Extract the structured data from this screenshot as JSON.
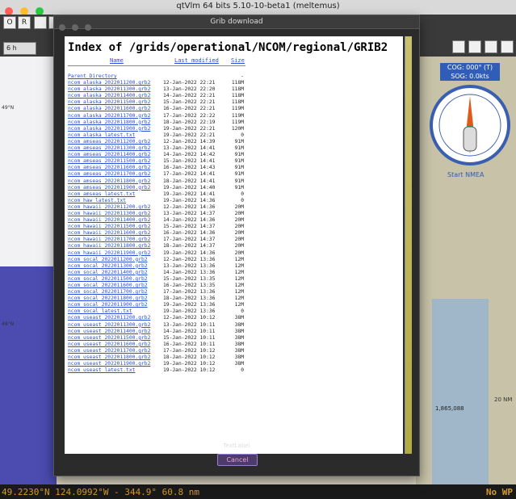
{
  "app": {
    "window_title": "qtVlm 64 bits 5.10-10-beta1 (meltemus)",
    "toolbar_select_value": "6 h",
    "toolbar_letters": [
      "O",
      "R"
    ]
  },
  "map": {
    "lat_label_top": "49°N",
    "lat_label_mid": "48°N",
    "cog": "COG: 000° (T)",
    "sog": "SOG: 0.0kts",
    "nmea_label": "Start NMEA",
    "scale_label": "20 NM",
    "distance_label": "1,865,088"
  },
  "status": {
    "coords": "49.2230°N 124.0992°W - 344.9° 60.8 nm",
    "waypoint": "No WP"
  },
  "dialog": {
    "title": "Grib download",
    "heading": "Index of /grids/operational/NCOM/regional/GRIB2",
    "col_name": "Name",
    "col_modified": "Last modified",
    "col_size": "Size",
    "text_label": "TextLabel",
    "cancel_label": "Cancel",
    "rows": [
      {
        "name": "Parent Directory",
        "date": "",
        "size": "-"
      },
      {
        "name": "ncom_alaska_2022011200.grb2",
        "date": "12-Jan-2022 22:21",
        "size": "118M"
      },
      {
        "name": "ncom_alaska_2022011300.grb2",
        "date": "13-Jan-2022 22:20",
        "size": "118M"
      },
      {
        "name": "ncom_alaska_2022011400.grb2",
        "date": "14-Jan-2022 22:21",
        "size": "118M"
      },
      {
        "name": "ncom_alaska_2022011500.grb2",
        "date": "15-Jan-2022 22:21",
        "size": "118M"
      },
      {
        "name": "ncom_alaska_2022011600.grb2",
        "date": "16-Jan-2022 22:21",
        "size": "119M"
      },
      {
        "name": "ncom_alaska_2022011700.grb2",
        "date": "17-Jan-2022 22:22",
        "size": "119M"
      },
      {
        "name": "ncom_alaska_2022011800.grb2",
        "date": "18-Jan-2022 22:19",
        "size": "119M"
      },
      {
        "name": "ncom_alaska_2022011900.grb2",
        "date": "19-Jan-2022 22:21",
        "size": "120M"
      },
      {
        "name": "ncom_alaska_latest.txt",
        "date": "19-Jan-2022 22:21",
        "size": "0"
      },
      {
        "name": "ncom_amseas_2022011200.grb2",
        "date": "12-Jan-2022 14:39",
        "size": "91M"
      },
      {
        "name": "ncom_amseas_2022011300.grb2",
        "date": "13-Jan-2022 14:41",
        "size": "91M"
      },
      {
        "name": "ncom_amseas_2022011400.grb2",
        "date": "14-Jan-2022 14:42",
        "size": "91M"
      },
      {
        "name": "ncom_amseas_2022011500.grb2",
        "date": "15-Jan-2022 14:41",
        "size": "91M"
      },
      {
        "name": "ncom_amseas_2022011600.grb2",
        "date": "16-Jan-2022 14:43",
        "size": "91M"
      },
      {
        "name": "ncom_amseas_2022011700.grb2",
        "date": "17-Jan-2022 14:41",
        "size": "91M"
      },
      {
        "name": "ncom_amseas_2022011800.grb2",
        "date": "18-Jan-2022 14:41",
        "size": "91M"
      },
      {
        "name": "ncom_amseas_2022011900.grb2",
        "date": "19-Jan-2022 14:40",
        "size": "91M"
      },
      {
        "name": "ncom_amseas_latest.txt",
        "date": "19-Jan-2022 14:41",
        "size": "0"
      },
      {
        "name": "ncom_haw_latest.txt",
        "date": "19-Jan-2022 14:36",
        "size": "0"
      },
      {
        "name": "ncom_hawaii_2022011200.grb2",
        "date": "12-Jan-2022 14:36",
        "size": "20M"
      },
      {
        "name": "ncom_hawaii_2022011300.grb2",
        "date": "13-Jan-2022 14:37",
        "size": "20M"
      },
      {
        "name": "ncom_hawaii_2022011400.grb2",
        "date": "14-Jan-2022 14:36",
        "size": "20M"
      },
      {
        "name": "ncom_hawaii_2022011500.grb2",
        "date": "15-Jan-2022 14:37",
        "size": "20M"
      },
      {
        "name": "ncom_hawaii_2022011600.grb2",
        "date": "16-Jan-2022 14:36",
        "size": "20M"
      },
      {
        "name": "ncom_hawaii_2022011700.grb2",
        "date": "17-Jan-2022 14:37",
        "size": "20M"
      },
      {
        "name": "ncom_hawaii_2022011800.grb2",
        "date": "18-Jan-2022 14:37",
        "size": "20M"
      },
      {
        "name": "ncom_hawaii_2022011900.grb2",
        "date": "19-Jan-2022 14:36",
        "size": "20M"
      },
      {
        "name": "ncom_socal_2022011200.grb2",
        "date": "12-Jan-2022 13:36",
        "size": "12M"
      },
      {
        "name": "ncom_socal_2022011300.grb2",
        "date": "13-Jan-2022 13:36",
        "size": "12M"
      },
      {
        "name": "ncom_socal_2022011400.grb2",
        "date": "14-Jan-2022 13:36",
        "size": "12M"
      },
      {
        "name": "ncom_socal_2022011500.grb2",
        "date": "15-Jan-2022 13:35",
        "size": "12M"
      },
      {
        "name": "ncom_socal_2022011600.grb2",
        "date": "16-Jan-2022 13:35",
        "size": "12M"
      },
      {
        "name": "ncom_socal_2022011700.grb2",
        "date": "17-Jan-2022 13:36",
        "size": "12M"
      },
      {
        "name": "ncom_socal_2022011800.grb2",
        "date": "18-Jan-2022 13:36",
        "size": "12M"
      },
      {
        "name": "ncom_socal_2022011900.grb2",
        "date": "19-Jan-2022 13:36",
        "size": "12M"
      },
      {
        "name": "ncom_socal_latest.txt",
        "date": "19-Jan-2022 13:36",
        "size": "0"
      },
      {
        "name": "ncom_useast_2022011200.grb2",
        "date": "12-Jan-2022 10:12",
        "size": "38M"
      },
      {
        "name": "ncom_useast_2022011300.grb2",
        "date": "13-Jan-2022 10:11",
        "size": "38M"
      },
      {
        "name": "ncom_useast_2022011400.grb2",
        "date": "14-Jan-2022 10:11",
        "size": "38M"
      },
      {
        "name": "ncom_useast_2022011500.grb2",
        "date": "15-Jan-2022 10:11",
        "size": "38M"
      },
      {
        "name": "ncom_useast_2022011600.grb2",
        "date": "16-Jan-2022 10:11",
        "size": "38M"
      },
      {
        "name": "ncom_useast_2022011700.grb2",
        "date": "17-Jan-2022 10:12",
        "size": "38M"
      },
      {
        "name": "ncom_useast_2022011800.grb2",
        "date": "18-Jan-2022 10:12",
        "size": "38M"
      },
      {
        "name": "ncom_useast_2022011900.grb2",
        "date": "19-Jan-2022 10:12",
        "size": "38M"
      },
      {
        "name": "ncom_useast_latest.txt",
        "date": "19-Jan-2022 10:12",
        "size": "0"
      }
    ]
  },
  "colors": {
    "link": "#2a4fd8",
    "status_text": "#d59a2a",
    "compass_ring": "#3b5fb0",
    "cancel_text": "#e6a1d8"
  }
}
